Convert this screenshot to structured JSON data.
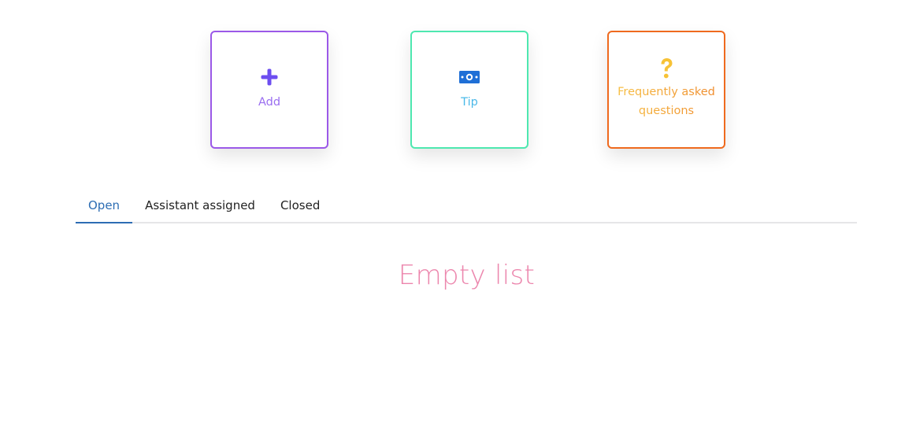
{
  "actions": [
    {
      "id": "add",
      "label": "Add",
      "icon": "plus-icon",
      "border_color": "#9b59e8",
      "icon_color": "#6d4ef0"
    },
    {
      "id": "tip",
      "label": "Tip",
      "icon": "money-bill-icon",
      "border_color": "#4ee8b0",
      "icon_color": "#1f6fd6"
    },
    {
      "id": "faq",
      "label": "Frequently asked questions",
      "icon": "question-mark-icon",
      "border_color": "#ef6a1e",
      "icon_color": "#f7c236"
    }
  ],
  "tabs": [
    {
      "label": "Open",
      "active": true
    },
    {
      "label": "Assistant assigned",
      "active": false
    },
    {
      "label": "Closed",
      "active": false
    }
  ],
  "colors": {
    "active_tab": "#2d6db3",
    "empty_text": "#ec86ad",
    "divider": "#e6e6e8"
  },
  "empty_state": {
    "message": "Empty list"
  }
}
